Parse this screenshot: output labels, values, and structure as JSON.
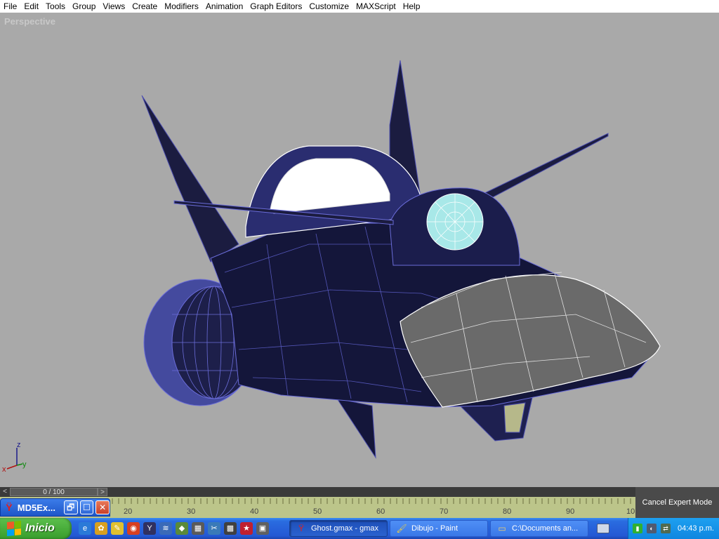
{
  "menu": {
    "items": [
      "File",
      "Edit",
      "Tools",
      "Group",
      "Views",
      "Create",
      "Modifiers",
      "Animation",
      "Graph Editors",
      "Customize",
      "MAXScript",
      "Help"
    ]
  },
  "viewport": {
    "label": "Perspective",
    "axis": {
      "z": "z",
      "x": "x",
      "y": "y"
    }
  },
  "timeline": {
    "left_arrow": "<",
    "right_arrow": ">",
    "frame_display": "0 / 100",
    "ticks": [
      "20",
      "30",
      "40",
      "50",
      "60",
      "70",
      "80",
      "90",
      "10"
    ],
    "cancel_expert": "Cancel Expert Mode"
  },
  "minimized_window": {
    "title": "MD5Ex...",
    "restore": "🗗",
    "maximize": "☐",
    "close": "✕"
  },
  "taskbar": {
    "start_label": "Inicio",
    "tasks": [
      {
        "label": "Ghost.gmax - gmax",
        "active": true
      },
      {
        "label": "Dibujo - Paint",
        "active": false
      },
      {
        "label": "C:\\Documents an...",
        "active": false
      }
    ],
    "clock": "04:43 p.m."
  },
  "colors": {
    "viewport_bg": "#a9a9a9",
    "hull": "#14163a",
    "wire": "#6a6cd8",
    "taskbar": "#2458d4",
    "start_green": "#389d2c"
  }
}
